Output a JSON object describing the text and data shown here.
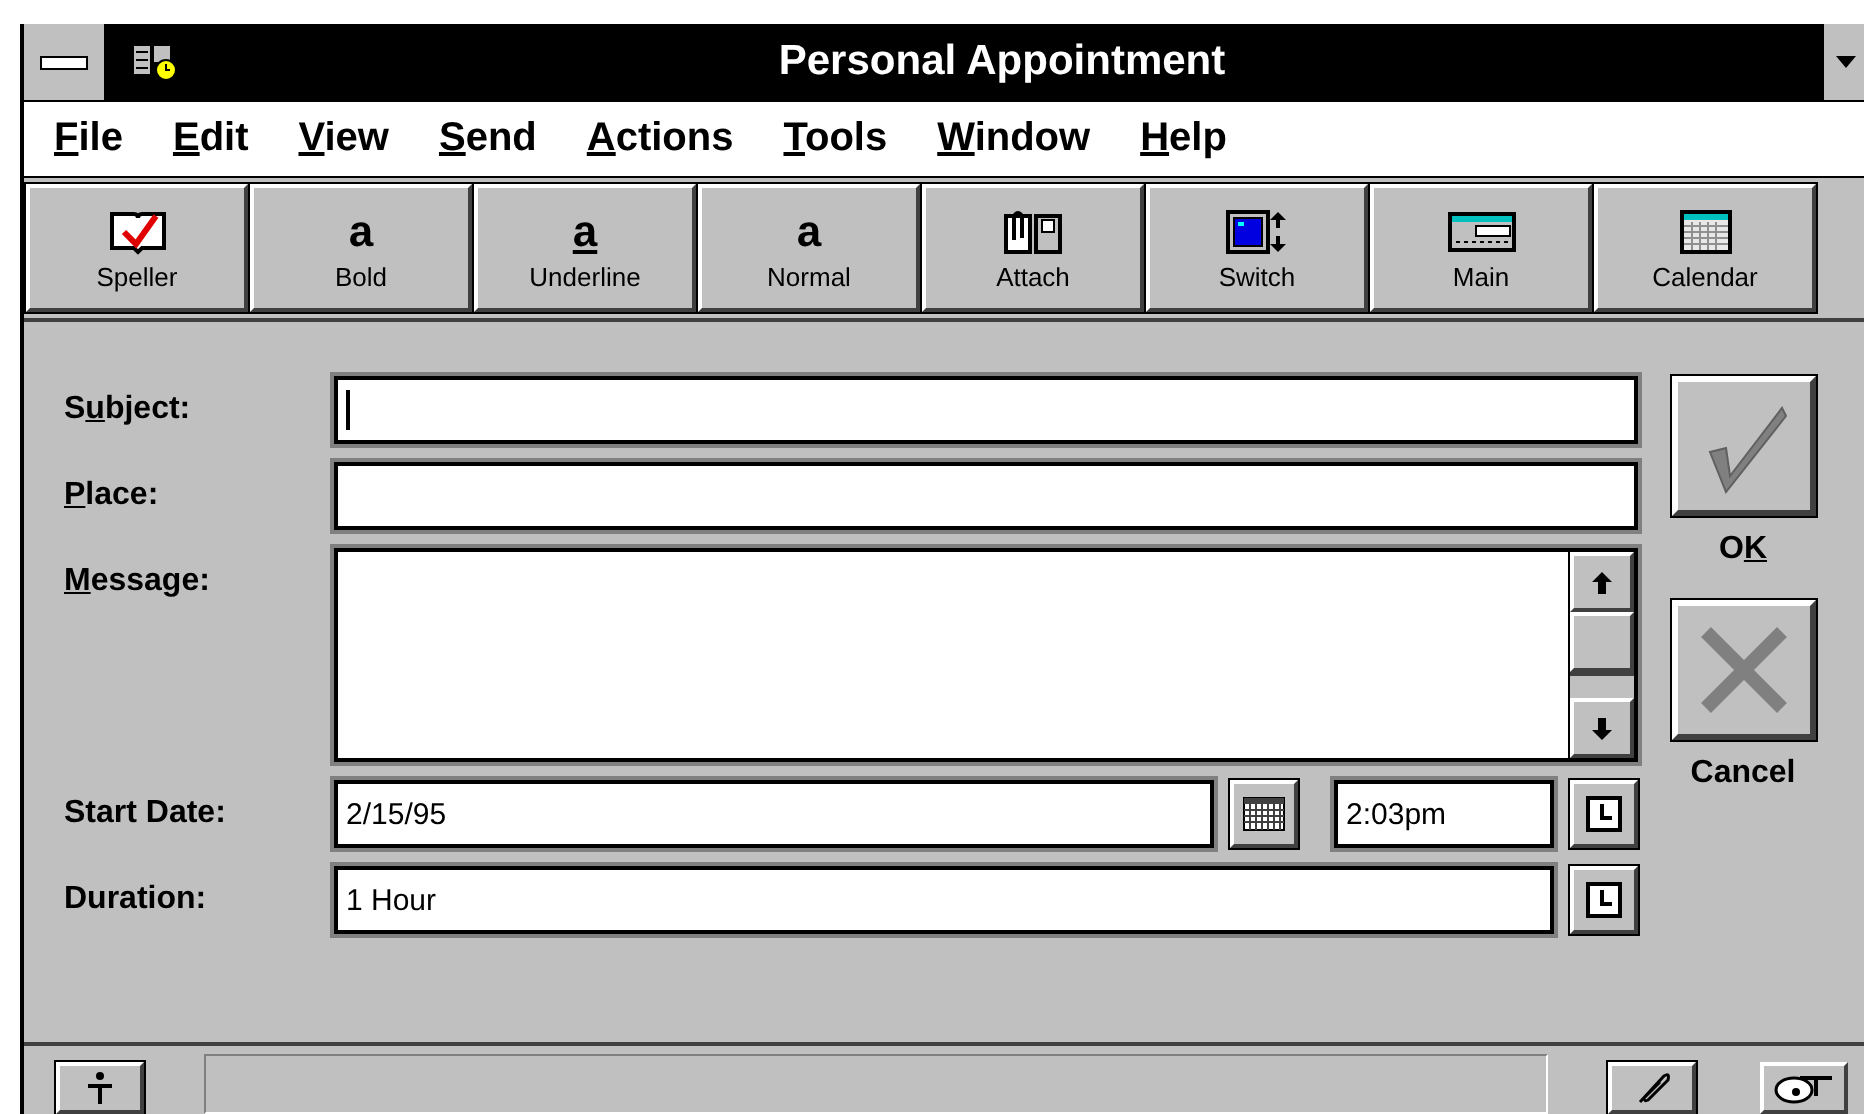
{
  "window": {
    "title": "Personal Appointment"
  },
  "menu": [
    {
      "label": [
        {
          "text": "F",
          "underlined": true
        },
        {
          "text": "ile",
          "underlined": false
        }
      ]
    },
    {
      "label": [
        {
          "text": "E",
          "underlined": true
        },
        {
          "text": "dit",
          "underlined": false
        }
      ]
    },
    {
      "label": [
        {
          "text": "V",
          "underlined": true
        },
        {
          "text": "iew",
          "underlined": false
        }
      ]
    },
    {
      "label": [
        {
          "text": "S",
          "underlined": true
        },
        {
          "text": "end",
          "underlined": false
        }
      ]
    },
    {
      "label": [
        {
          "text": "A",
          "underlined": true
        },
        {
          "text": "ctions",
          "underlined": false
        }
      ]
    },
    {
      "label": [
        {
          "text": "T",
          "underlined": true
        },
        {
          "text": "ools",
          "underlined": false
        }
      ]
    },
    {
      "label": [
        {
          "text": "W",
          "underlined": true
        },
        {
          "text": "indow",
          "underlined": false
        }
      ]
    },
    {
      "label": [
        {
          "text": "H",
          "underlined": true
        },
        {
          "text": "elp",
          "underlined": false
        }
      ]
    }
  ],
  "toolbar": [
    {
      "kind": "speller",
      "label": "Speller"
    },
    {
      "kind": "bold",
      "glyph": "a",
      "label": "Bold"
    },
    {
      "kind": "underline",
      "glyph": "a",
      "label": "Underline"
    },
    {
      "kind": "normal",
      "glyph": "a",
      "label": "Normal"
    },
    {
      "kind": "attach",
      "label": "Attach"
    },
    {
      "kind": "switch",
      "label": "Switch"
    },
    {
      "kind": "main",
      "label": "Main"
    },
    {
      "kind": "calendar",
      "label": "Calendar"
    }
  ],
  "form": {
    "subject": {
      "label": [
        {
          "text": "S",
          "underlined": false
        },
        {
          "text": "u",
          "underlined": true
        },
        {
          "text": "bject:",
          "underlined": false
        }
      ],
      "focused": true
    },
    "place": {
      "label": [
        {
          "text": "P",
          "underlined": true
        },
        {
          "text": "lace:",
          "underlined": false
        }
      ]
    },
    "message": {
      "label": [
        {
          "text": "M",
          "underlined": true
        },
        {
          "text": "essage:",
          "underlined": false
        }
      ]
    },
    "start_date": {
      "label": "Start Date:",
      "date": "2/15/95",
      "time": "2:03pm"
    },
    "duration": {
      "label": "Duration:",
      "value": "1 Hour"
    }
  },
  "actions": [
    {
      "kind": "ok",
      "label": [
        {
          "text": "O",
          "underlined": false
        },
        {
          "text": "K",
          "underlined": true
        }
      ]
    },
    {
      "kind": "cancel",
      "label": [
        {
          "text": "Cancel",
          "underlined": false
        }
      ]
    }
  ]
}
